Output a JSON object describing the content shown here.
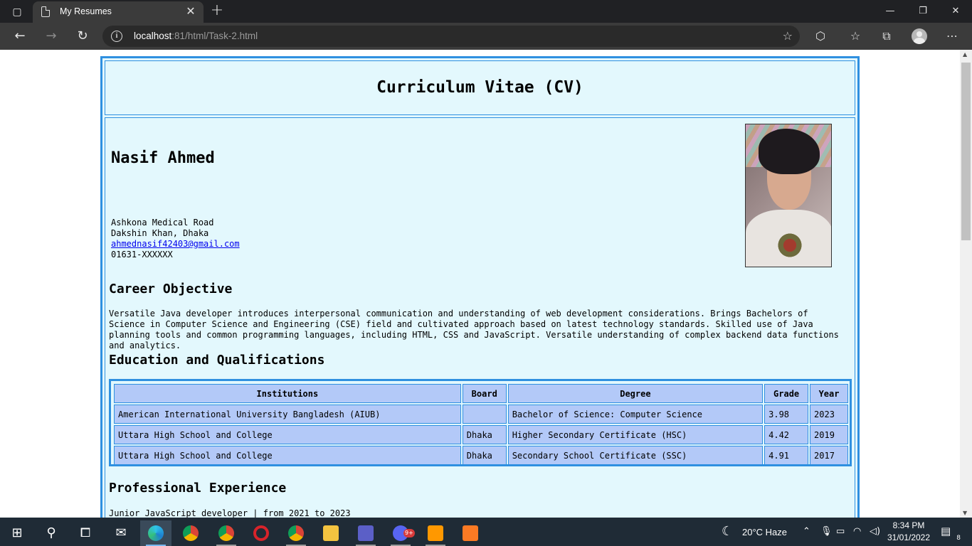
{
  "browser": {
    "tab_title": "My Resumes",
    "new_tab_symbol": "+",
    "url_host": "localhost",
    "url_rest": ":81/html/Task-2.html",
    "window_controls": [
      "minimize",
      "restore",
      "close"
    ]
  },
  "cv": {
    "heading": "Curriculum Vitae (CV)",
    "name": "Nasif Ahmed",
    "address_line1": "Ashkona Medical Road",
    "address_line2": "Dakshin Khan, Dhaka",
    "email": "ahmednasif42403@gmail.com",
    "phone": "01631-XXXXXX",
    "career_title": "Career Objective",
    "career_text": "Versatile Java developer introduces interpersonal communication and understanding of web development considerations. Brings Bachelors of Science in Computer Science and Engineering (CSE) field and cultivated approach based on latest technology standards. Skilled use of Java planning tools and common programming languages, including HTML, CSS and JavaScript. Versatile understanding of complex backend data functions and analytics.",
    "education_title": "Education and Qualifications",
    "education_headers": [
      "Institutions",
      "Board",
      "Degree",
      "Grade",
      "Year"
    ],
    "education_rows": [
      [
        "American International University Bangladesh (AIUB)",
        "",
        "Bachelor of Science: Computer Science",
        "3.98",
        "2023"
      ],
      [
        "Uttara High School and College",
        "Dhaka",
        "Higher Secondary Certificate (HSC)",
        "4.42",
        "2019"
      ],
      [
        "Uttara High School and College",
        "Dhaka",
        "Secondary School Certificate (SSC)",
        "4.91",
        "2017"
      ]
    ],
    "experience_title": "Professional Experience",
    "experience_line": "Junior JavaScript developer | from 2021 to 2023"
  },
  "taskbar": {
    "weather": "20°C  Haze",
    "time": "8:34 PM",
    "date": "31/01/2022",
    "notification_count": "8",
    "badge_9plus": "9+"
  },
  "colors": {
    "accent_border": "#2f90e0",
    "cv_background": "#e3f8fd",
    "table_cell": "#b3c9f8"
  }
}
